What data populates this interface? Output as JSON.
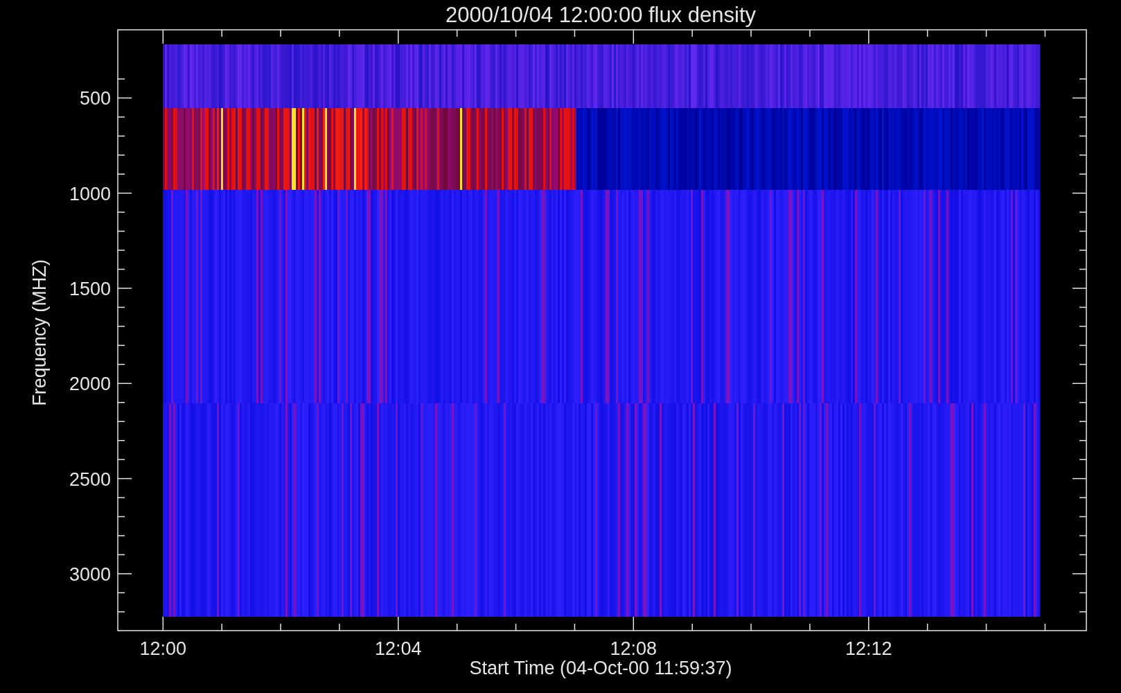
{
  "plot": {
    "title": "2000/10/04 12:00:00 flux density",
    "xlabel": "Start Time (04-Oct-00 11:59:37)",
    "ylabel": "Frequency (MHZ)",
    "xticks": [
      "12:00",
      "12:04",
      "12:08",
      "12:12"
    ],
    "yticks": [
      "500",
      "1000",
      "1500",
      "2000",
      "2500",
      "3000"
    ]
  }
}
